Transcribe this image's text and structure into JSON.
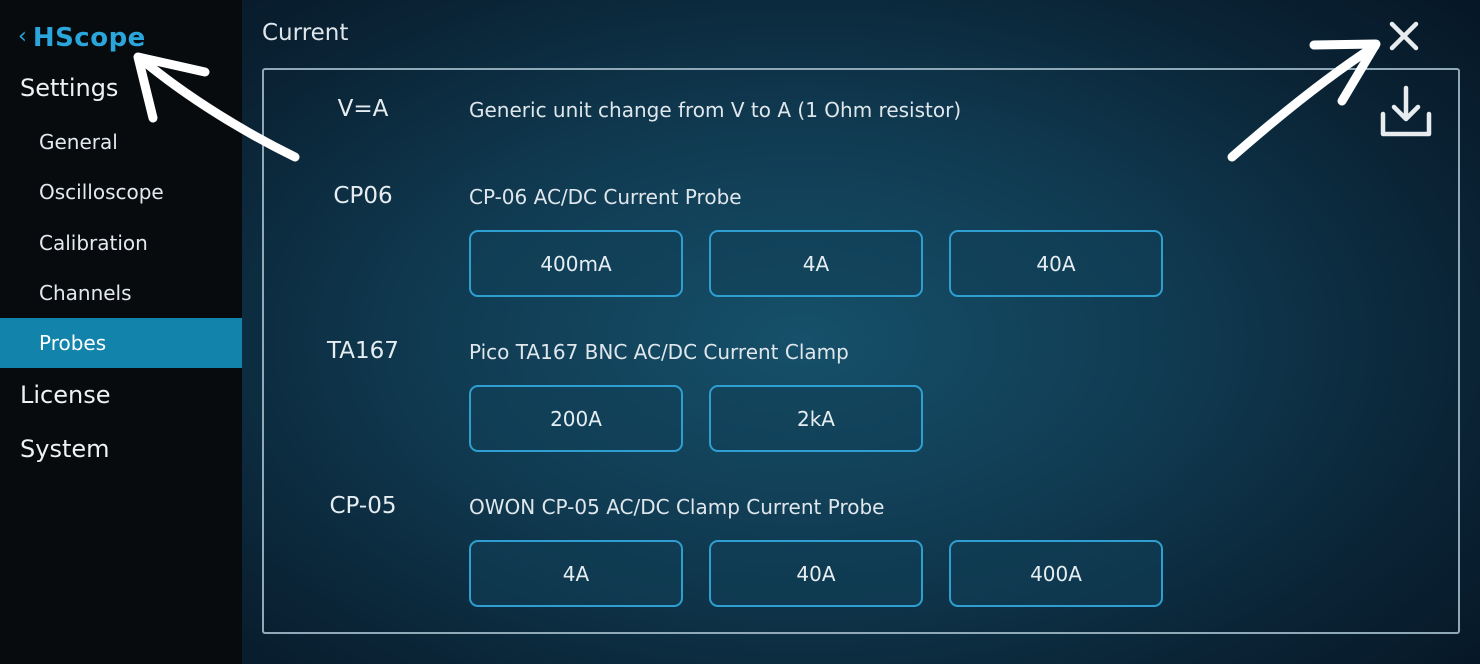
{
  "app": {
    "back_chevron": "‹",
    "brand": "HScope"
  },
  "sidebar": {
    "sections": [
      {
        "label": "Settings"
      },
      {
        "label": "License"
      },
      {
        "label": "System"
      }
    ],
    "settings_items": [
      {
        "label": "General"
      },
      {
        "label": "Oscilloscope"
      },
      {
        "label": "Calibration"
      },
      {
        "label": "Channels"
      },
      {
        "label": "Probes",
        "active": true
      }
    ]
  },
  "main": {
    "title": "Current",
    "icons": {
      "close": "close-icon",
      "download": "download-icon"
    },
    "probes": [
      {
        "code": "V=A",
        "description": "Generic unit change from V to A (1 Ohm resistor)",
        "ranges": []
      },
      {
        "code": "CP06",
        "description": "CP-06 AC/DC Current Probe",
        "ranges": [
          "400mA",
          "4A",
          "40A"
        ]
      },
      {
        "code": "TA167",
        "description": "Pico TA167 BNC AC/DC Current Clamp",
        "ranges": [
          "200A",
          "2kA"
        ]
      },
      {
        "code": "CP-05",
        "description": "OWON CP-05 AC/DC Clamp Current Probe",
        "ranges": [
          "4A",
          "40A",
          "400A"
        ]
      }
    ]
  },
  "colors": {
    "accent": "#2aa6dc",
    "active_item": "#1283ab",
    "sidebar_bg": "#080b0e",
    "panel_border": "#8fa9b8",
    "button_border": "#2f9fd1"
  }
}
